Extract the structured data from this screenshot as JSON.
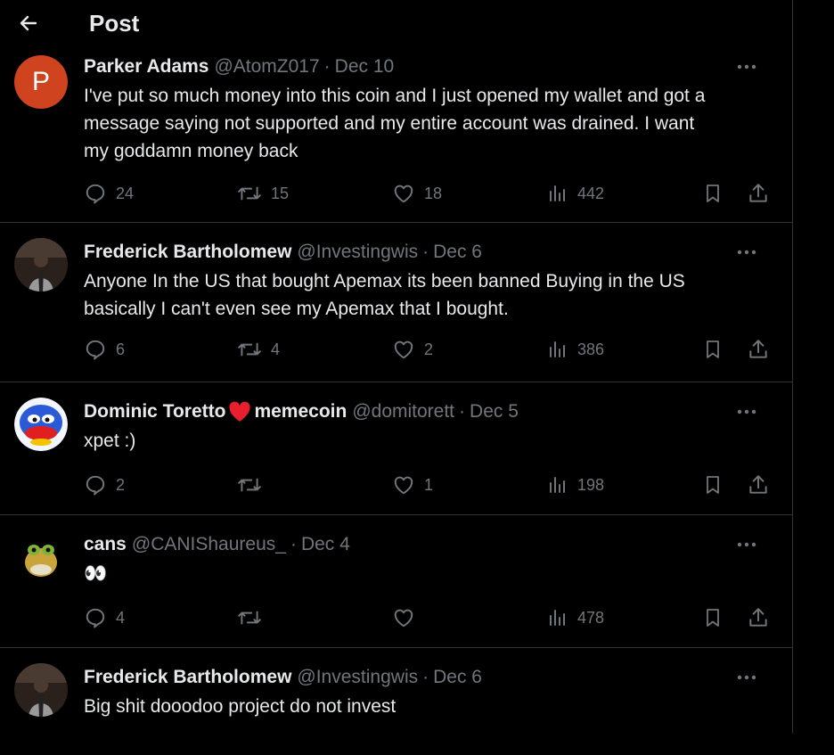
{
  "header": {
    "title": "Post"
  },
  "posts": [
    {
      "name": "Parker Adams",
      "name_suffix": "",
      "handle": "@AtomZ017",
      "date": "Dec 10",
      "avatar_letter": "P",
      "text_lines": [
        "I've put so much money into this coin and I just opened my wallet and got a",
        "message saying not supported and my entire account was drained. I want",
        "my goddamn money back"
      ],
      "replies": "24",
      "retweets": "15",
      "likes": "18",
      "views": "442"
    },
    {
      "name": "Frederick Bartholomew",
      "name_suffix": "",
      "handle": "@Investingwis",
      "date": "Dec 6",
      "avatar_letter": "",
      "text_lines": [
        "Anyone In the US that bought Apemax its been banned Buying in the US",
        "basically I can't even see my Apemax that I bought."
      ],
      "replies": "6",
      "retweets": "4",
      "likes": "2",
      "views": "386"
    },
    {
      "name": "Dominic Toretto",
      "name_suffix": "memecoin",
      "handle": "@domitorett",
      "date": "Dec 5",
      "avatar_letter": "",
      "text_lines": [
        "xpet :)"
      ],
      "replies": "2",
      "retweets": "",
      "likes": "1",
      "views": "198"
    },
    {
      "name": "cans",
      "name_suffix": "",
      "handle": "@CANIShaureus_",
      "date": "Dec 4",
      "avatar_letter": "",
      "text_lines": [
        "👀"
      ],
      "replies": "4",
      "retweets": "",
      "likes": "",
      "views": "478"
    },
    {
      "name": "Frederick Bartholomew",
      "name_suffix": "",
      "handle": "@Investingwis",
      "date": "Dec 6",
      "avatar_letter": "",
      "text_lines": [
        "Big shit dooodoo project do not invest"
      ],
      "replies": "",
      "retweets": "",
      "likes": "",
      "views": ""
    }
  ],
  "separator": "·"
}
